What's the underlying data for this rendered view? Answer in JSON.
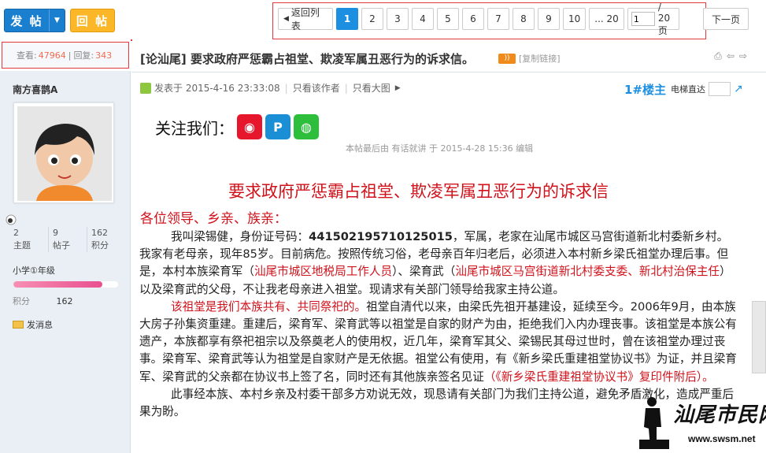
{
  "toolbar": {
    "post_label": "发 帖",
    "reply_label": "回 帖"
  },
  "pager": {
    "back_label": "返回列表",
    "pages": [
      "1",
      "2",
      "3",
      "4",
      "5",
      "6",
      "7",
      "8",
      "9",
      "10"
    ],
    "current_page": "1",
    "ellipsis_last": "... 20",
    "jump_value": "1",
    "total_label": "/ 20 页",
    "next_label": "下一页"
  },
  "thread_stats": {
    "views_label": "查看:",
    "views": "47964",
    "sep": "|",
    "replies_label": "回复:",
    "replies": "343"
  },
  "author": {
    "name": "南方喜鹊A",
    "stats": [
      {
        "value": "2",
        "label": "主题"
      },
      {
        "value": "9",
        "label": "帖子"
      },
      {
        "value": "162",
        "label": "积分"
      }
    ],
    "level": "小学①年级",
    "level_progress": 0.85,
    "credits_label": "积分",
    "credits_value": "162",
    "send_message": "发消息"
  },
  "thread": {
    "category": "[论汕尾]",
    "title": "要求政府严惩霸占祖堂、欺凌军属丑恶行为的诉求信。",
    "copy_link": "[复制链接]"
  },
  "post": {
    "posted_at": "发表于 2015-4-16 23:33:08",
    "only_author": "只看该作者",
    "only_big_images": "只看大图",
    "floor": "1#楼主",
    "elevator": "电梯直达",
    "follow_label": "关注我们：",
    "edit_info": "本帖最后由 有话就讲 于 2015-4-28 15:36 编辑",
    "content_title": "要求政府严惩霸占祖堂、欺凌军属丑恶行为的诉求信",
    "greeting": "各位领导、乡亲、族亲：",
    "p1": {
      "t1": "我叫梁锡健，身份证号码：",
      "id": "441502195710125015",
      "t2": "，军属，老家在汕尾市城区马宫街道新北村委新乡村。我家有老母亲，现年85岁。目前病危。按照传统习俗，老母亲百年归老后，必须进入本村新乡梁氏祖堂办理后事。但是，本村本族梁育军（",
      "r1": "汕尾市城区地税局工作人员",
      "t3": "）、梁育武（",
      "r2": "汕尾市城区马宫街道新北村委支委、新北村治保主任",
      "t4": "）以及梁育武的父母，不让我老母亲进入祖堂。现请求有关部门领导给我家主持公道。"
    },
    "p2": {
      "r1": "该祖堂是我们本族共有、共同祭祀的。",
      "t1": "祖堂自清代以来，由梁氏先祖开基建设，延续至今。2006年9月，由本族大房子孙集资重建。重建后，梁育军、梁育武等以祖堂是自家的财产为由，拒绝我们入内办理丧事。该祖堂是本族公有遗产，本族都享有祭祀祖宗以及祭奠老人的使用权，近几年，梁育军其父、梁锡民其母过世时，曾在该祖堂办理过丧事。梁育军、梁育武等认为祖堂是自家财产是无依据。祖堂公有使用，有《新乡梁氏重建祖堂协议书》为证，并且梁育军、梁育武的父亲都在协议书上签了名，同时还有其他族亲签名见证",
      "r2": "（《新乡梁氏重建祖堂协议书》复印件附后）。"
    },
    "p3": "此事经本族、本村乡亲及村委干部多方劝说无效，现恳请有关部门为我们主持公道，避免矛盾激化，造成严重后果为盼。"
  },
  "watermark": {
    "text": "汕尾市民网",
    "url": "www.swsm.net"
  },
  "colors": {
    "accent_blue": "#1d8fe1",
    "post_button": "#1b7fd0",
    "reply_button": "#fbb728",
    "red_text": "#d0121b",
    "stat_number": "#f26c4f"
  },
  "icons": {
    "weibo": "weibo-icon",
    "tencent_weibo": "tencent-weibo-icon",
    "wechat": "wechat-icon",
    "print": "print-icon",
    "prev_thread": "prev-thread-icon",
    "next_thread": "next-thread-icon"
  }
}
